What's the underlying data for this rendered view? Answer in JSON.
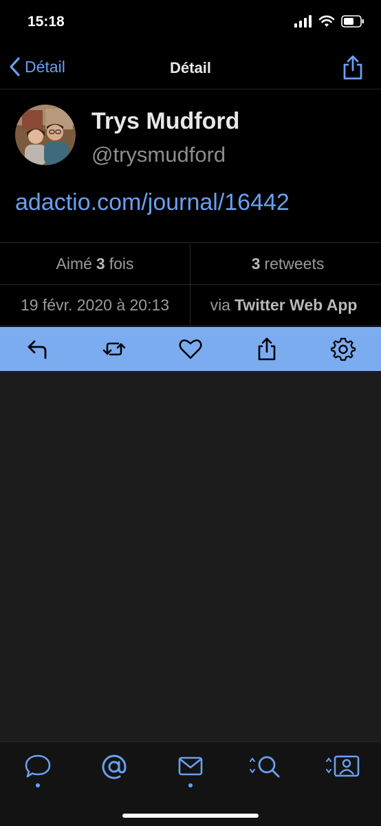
{
  "status": {
    "time": "15:18"
  },
  "nav": {
    "back_label": "Détail",
    "title": "Détail"
  },
  "profile": {
    "name": "Trys Mudford",
    "handle": "@trysmudford",
    "link": "adactio.com/journal/16442"
  },
  "stats": {
    "likes_prefix": "Aimé",
    "likes_count": "3",
    "likes_suffix": "fois",
    "retweets_count": "3",
    "retweets_label": "retweets",
    "date": "19 févr. 2020 à 20:13",
    "via_prefix": "via",
    "via_app": "Twitter Web App"
  },
  "actions": [
    "reply-icon",
    "retweet-icon",
    "heart-icon",
    "share-icon",
    "gear-icon"
  ],
  "tabs": [
    "chat-bubble-icon",
    "at-mention-icon",
    "mail-icon",
    "search-icon",
    "profile-icon"
  ],
  "colors": {
    "accent": "#6aa0f0",
    "action_bar": "#7cacf0",
    "background": "#000000",
    "content": "#1c1c1c"
  }
}
